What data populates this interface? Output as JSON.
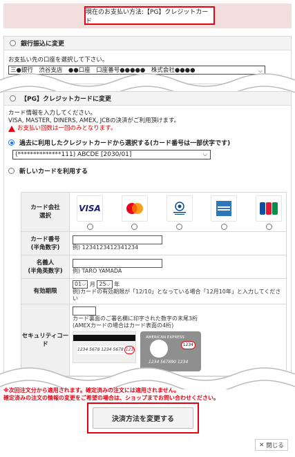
{
  "current_method": {
    "label": "現在のお支払い方法:【PG】クレジットカード"
  },
  "bank_section": {
    "title": "銀行振込に変更",
    "instruction": "お支払い先の口座を選択して下さい。",
    "account_select_value": "三●銀行　渋谷支店　●●口座　口座番号●●●●●　株式会社●●●●"
  },
  "card_section": {
    "title": "【PG】クレジットカードに変更",
    "info_line1": "カード情報を入力してください。",
    "info_line2": "VISA, MASTER, DINERS, AMEX, JCBの決済がご利用頂けます。",
    "warning": "お支払い回数は一回のみとなります。",
    "past_card_option": "過去に利用したクレジットカードから選択する(カード番号は一部伏字です)",
    "past_card_value": "(**************111)  ABCDE [2030/01]",
    "new_card_option": "新しいカードを利用する",
    "brand_label": "カード会社\n選択",
    "brands": [
      {
        "name": "VISA",
        "icon": "visa-logo"
      },
      {
        "name": "Mastercard",
        "icon": "mastercard-logo"
      },
      {
        "name": "Diners Club",
        "icon": "diners-logo"
      },
      {
        "name": "AMERICAN EXPRESS",
        "icon": "amex-logo"
      },
      {
        "name": "JCB",
        "icon": "jcb-logo"
      }
    ],
    "card_number_label": "カード番号\n(半角数字)",
    "card_number_example": "例) 1234123412341234",
    "holder_label": "名義人\n(半角英数字)",
    "holder_example": "例) TARO YAMADA",
    "expiry_label": "有効期限",
    "expiry_month": "01",
    "expiry_month_unit": "月",
    "expiry_year": "25",
    "expiry_year_unit": "年",
    "expiry_example": "例)カードの有効期限が「12/10」となっている場合「12月10年」と入力してください",
    "cvc_label": "セキュリティコー\nド",
    "cvc_note1": "カード裏面のご署名欄に印字された数字の末尾3桁",
    "cvc_note2": "(AMEXカードの場合はカード表面の4桁)",
    "cvc_example_number": "1234 5678 1234 5678",
    "cvc_example_code": "123",
    "amex_example_brand": "AMERICAN EXPRESS",
    "amex_example_code": "1234",
    "amex_example_number": "1234 567890 1234"
  },
  "notes": {
    "line1": "※次回注文分から適用されます。確定済みの注文には適用されません。",
    "line2": "確定済みの注文の情報の変更をご希望の場合は、ショップまでお問い合わせください。"
  },
  "submit_label": "決済方法を変更する",
  "close_label": "閉じる",
  "colors": {
    "highlight": "#e60012",
    "header_bg": "#f2dedd"
  }
}
